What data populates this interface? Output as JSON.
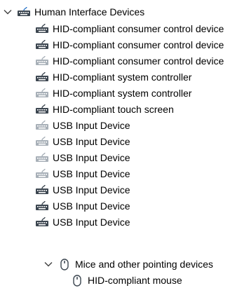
{
  "tree": {
    "hid_group": {
      "label": "Human Interface Devices",
      "expanded": true,
      "icon": "hid-category-icon",
      "children": [
        {
          "label": "HID-compliant consumer control device",
          "icon": "hid-device-icon",
          "dimmed": false
        },
        {
          "label": "HID-compliant consumer control device",
          "icon": "hid-device-icon",
          "dimmed": false
        },
        {
          "label": "HID-compliant consumer control device",
          "icon": "hid-device-icon",
          "dimmed": true
        },
        {
          "label": "HID-compliant system controller",
          "icon": "hid-device-icon",
          "dimmed": false
        },
        {
          "label": "HID-compliant system controller",
          "icon": "hid-device-icon",
          "dimmed": true
        },
        {
          "label": "HID-compliant touch screen",
          "icon": "hid-device-icon",
          "dimmed": false
        },
        {
          "label": "USB Input Device",
          "icon": "hid-device-icon",
          "dimmed": true
        },
        {
          "label": "USB Input Device",
          "icon": "hid-device-icon",
          "dimmed": true
        },
        {
          "label": "USB Input Device",
          "icon": "hid-device-icon",
          "dimmed": true
        },
        {
          "label": "USB Input Device",
          "icon": "hid-device-icon",
          "dimmed": true
        },
        {
          "label": "USB Input Device",
          "icon": "hid-device-icon",
          "dimmed": false
        },
        {
          "label": "USB Input Device",
          "icon": "hid-device-icon",
          "dimmed": false
        },
        {
          "label": "USB Input Device",
          "icon": "hid-device-icon",
          "dimmed": false
        }
      ]
    },
    "mice_group": {
      "label": "Mice and other pointing devices",
      "expanded": true,
      "icon": "mouse-icon",
      "children": [
        {
          "label": "HID-compliant mouse",
          "icon": "mouse-icon"
        }
      ]
    }
  },
  "colors": {
    "text": "#000000",
    "chevron": "#404040",
    "icon_dark": "#3c4650",
    "icon_dim": "#a8b0b8"
  }
}
